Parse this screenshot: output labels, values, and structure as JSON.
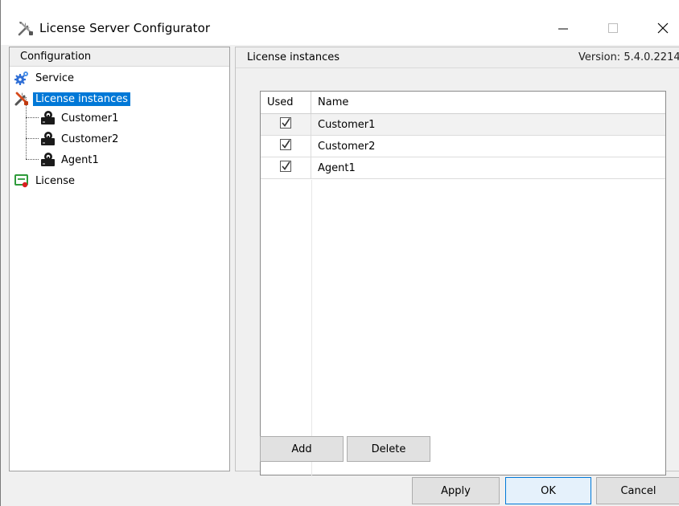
{
  "window": {
    "title": "License Server Configurator",
    "controls": {
      "minimize": "minimize-icon",
      "maximize": "maximize-icon",
      "close": "close-icon"
    }
  },
  "left_panel": {
    "header": "Configuration",
    "tree": [
      {
        "label": "Service",
        "icon": "gear-icon",
        "level": 0,
        "selected": false
      },
      {
        "label": "License instances",
        "icon": "tools-icon",
        "level": 0,
        "selected": true
      },
      {
        "label": "Customer1",
        "icon": "server-icon",
        "level": 1,
        "selected": false
      },
      {
        "label": "Customer2",
        "icon": "server-icon",
        "level": 1,
        "selected": false
      },
      {
        "label": "Agent1",
        "icon": "server-icon",
        "level": 1,
        "selected": false
      },
      {
        "label": "License",
        "icon": "license-icon",
        "level": 0,
        "selected": false
      }
    ]
  },
  "right_panel": {
    "title": "License instances",
    "version": "Version: 5.4.0.2214",
    "grid": {
      "columns": [
        "Used",
        "Name"
      ],
      "rows": [
        {
          "used": true,
          "name": "Customer1"
        },
        {
          "used": true,
          "name": "Customer2"
        },
        {
          "used": true,
          "name": "Agent1"
        }
      ]
    },
    "add_label": "Add",
    "delete_label": "Delete"
  },
  "footer": {
    "apply_label": "Apply",
    "ok_label": "OK",
    "cancel_label": "Cancel"
  },
  "colors": {
    "selection": "#0078d7",
    "window_bg": "#f0f0f0",
    "ok_button_bg": "#e5f1fb"
  }
}
